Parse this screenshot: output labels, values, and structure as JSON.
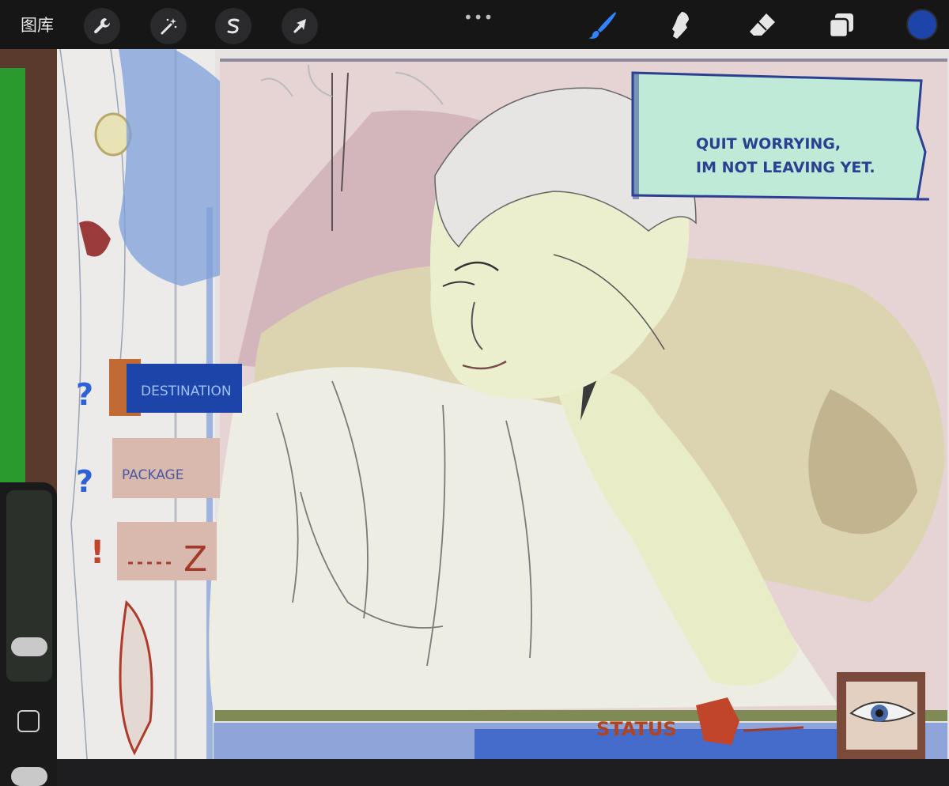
{
  "topbar": {
    "gallery_label": "图库",
    "left_tools": [
      "wrench-icon",
      "magic-wand-icon",
      "selection-icon",
      "transform-arrow-icon"
    ],
    "more_label": "•••",
    "right_tools": [
      "brush-icon",
      "smudge-icon",
      "eraser-icon",
      "layers-icon"
    ],
    "active_tool": "brush",
    "current_color": "#1d44a8"
  },
  "artwork": {
    "speech_line1": "QUIT WORRYING,",
    "speech_line2": "IM NOT LEAVING YET.",
    "label_destination": "DESTINATION",
    "label_package": "PACKAGE",
    "label_third": "Z",
    "status_label": "STATUS",
    "question_mark": "?",
    "exclamation": "!"
  },
  "colors": {
    "accent_blue": "#1d44a8",
    "green_panel": "#2a9a2e",
    "speech_bg": "#bfead7"
  }
}
